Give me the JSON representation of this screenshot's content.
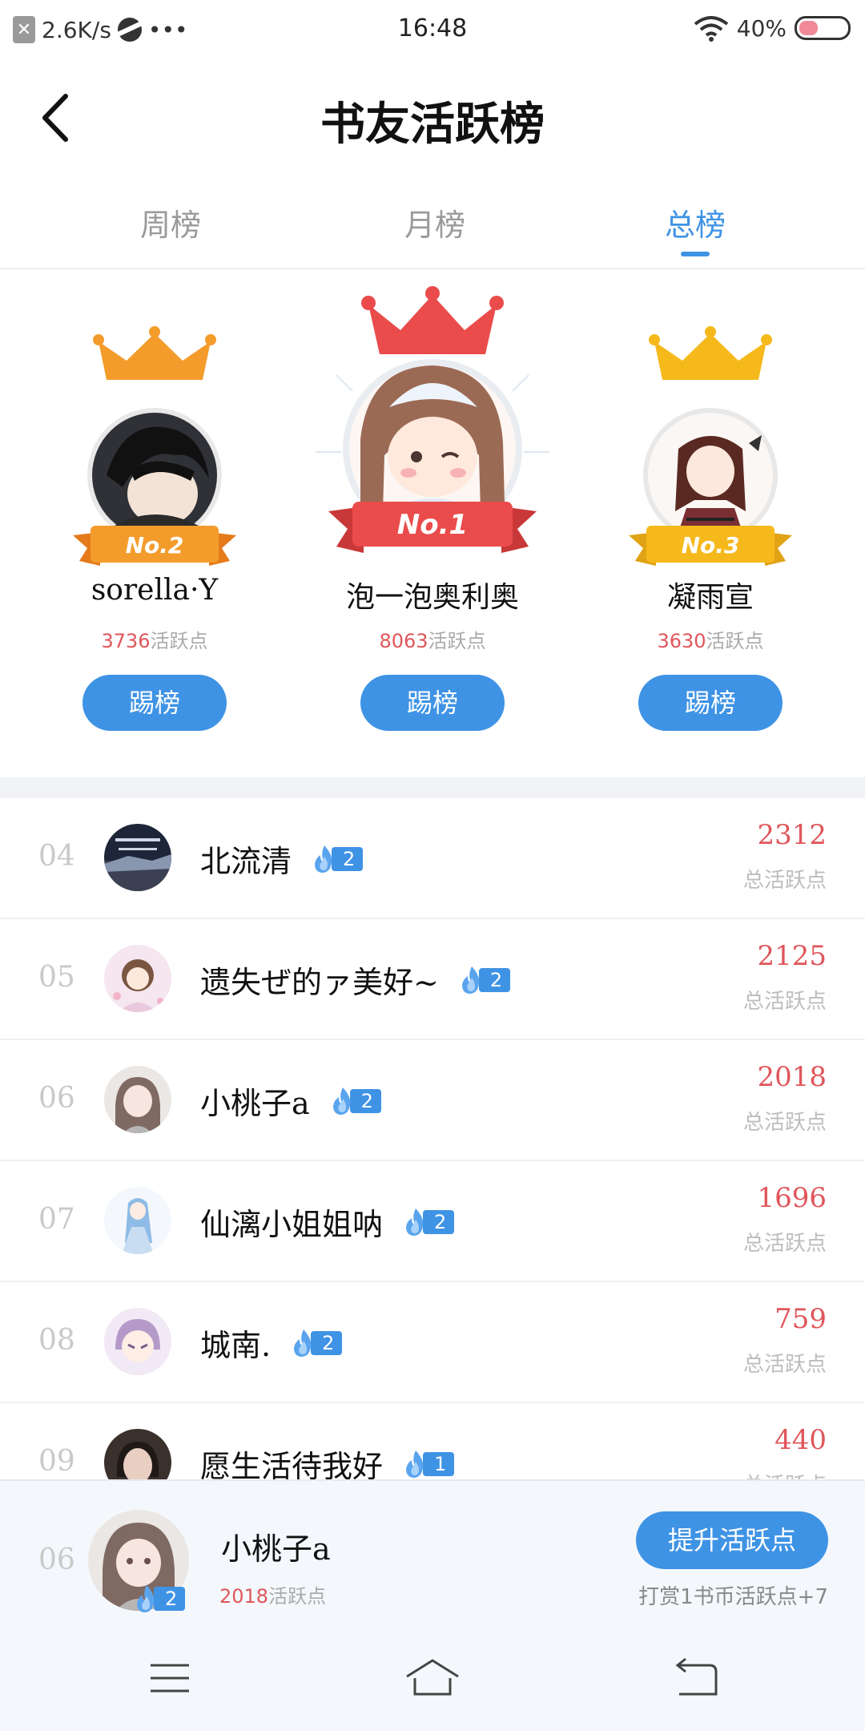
{
  "status_bar": {
    "net_speed": "2.6K/s",
    "dots": "•••",
    "time": "16:48",
    "battery": "40%",
    "battery_level": 0.4
  },
  "header": {
    "title": "书友活跃榜"
  },
  "tabs": [
    {
      "label": "周榜",
      "active": false
    },
    {
      "label": "月榜",
      "active": false
    },
    {
      "label": "总榜",
      "active": true
    }
  ],
  "podium": [
    {
      "badge": "No.2",
      "name": "sorella·Y",
      "points": "3736",
      "points_label": "活跃点",
      "button": "踢榜",
      "crown_color": "#f39c2c"
    },
    {
      "badge": "No.1",
      "name": "泡一泡奥利奥",
      "points": "8063",
      "points_label": "活跃点",
      "button": "踢榜",
      "crown_color": "#ea4b4b"
    },
    {
      "badge": "No.3",
      "name": "凝雨宣",
      "points": "3630",
      "points_label": "活跃点",
      "button": "踢榜",
      "crown_color": "#f6b91c"
    }
  ],
  "ranking": [
    {
      "rank": "04",
      "name": "北流清",
      "level": "2",
      "score": "2312",
      "score_label": "总活跃点"
    },
    {
      "rank": "05",
      "name": "遗失ぜ的ァ美好~",
      "level": "2",
      "score": "2125",
      "score_label": "总活跃点"
    },
    {
      "rank": "06",
      "name": "小桃子a",
      "level": "2",
      "score": "2018",
      "score_label": "总活跃点"
    },
    {
      "rank": "07",
      "name": "仙漓小姐姐呐",
      "level": "2",
      "score": "1696",
      "score_label": "总活跃点"
    },
    {
      "rank": "08",
      "name": "城南.",
      "level": "2",
      "score": "759",
      "score_label": "总活跃点"
    },
    {
      "rank": "09",
      "name": "愿生活待我好",
      "level": "1",
      "score": "440",
      "score_label": "总活跃点"
    }
  ],
  "me": {
    "rank": "06",
    "name": "小桃子a",
    "level": "2",
    "points": "2018",
    "points_label": "活跃点",
    "button": "提升活跃点",
    "hint": "打赏1书币活跃点+7"
  },
  "colors": {
    "accent": "#3f93e5",
    "score_red": "#e0565b"
  },
  "icons": {
    "back": "chevron-left-icon",
    "flame": "flame-icon",
    "menu": "menu-icon",
    "home": "home-icon",
    "return": "return-icon"
  }
}
